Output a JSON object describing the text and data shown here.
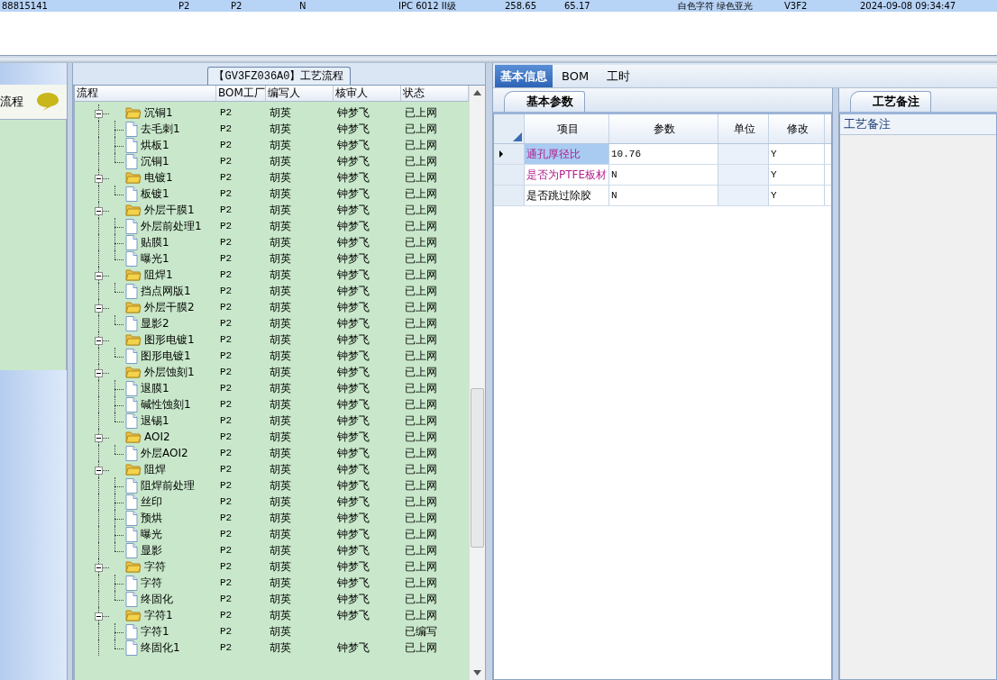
{
  "top_row": {
    "selected": true,
    "cells": [
      "88815141",
      "P2",
      "P2",
      "N",
      "IPC 6012 II级",
      "258.65",
      "65.17",
      "白色字符 绿色亚光",
      "V3F2",
      "2024-09-08 09:34:47"
    ]
  },
  "left_panel": {
    "title": "流程"
  },
  "process_panel": {
    "title": "【GV3FZ036A0】工艺流程",
    "columns": [
      "流程",
      "BOM工厂",
      "编写人",
      "核审人",
      "状态"
    ],
    "rows": [
      {
        "name": "沉铜1",
        "bom": "P2",
        "writer": "胡英",
        "reviewer": "钟梦飞",
        "status": "已上网",
        "expanded": true,
        "children": [
          {
            "name": "去毛刺1",
            "bom": "P2",
            "writer": "胡英",
            "reviewer": "钟梦飞",
            "status": "已上网"
          },
          {
            "name": "烘板1",
            "bom": "P2",
            "writer": "胡英",
            "reviewer": "钟梦飞",
            "status": "已上网"
          },
          {
            "name": "沉铜1",
            "bom": "P2",
            "writer": "胡英",
            "reviewer": "钟梦飞",
            "status": "已上网"
          }
        ]
      },
      {
        "name": "电镀1",
        "bom": "P2",
        "writer": "胡英",
        "reviewer": "钟梦飞",
        "status": "已上网",
        "expanded": true,
        "children": [
          {
            "name": "板镀1",
            "bom": "P2",
            "writer": "胡英",
            "reviewer": "钟梦飞",
            "status": "已上网"
          }
        ]
      },
      {
        "name": "外层干膜1",
        "bom": "P2",
        "writer": "胡英",
        "reviewer": "钟梦飞",
        "status": "已上网",
        "expanded": true,
        "children": [
          {
            "name": "外层前处理1",
            "bom": "P2",
            "writer": "胡英",
            "reviewer": "钟梦飞",
            "status": "已上网"
          },
          {
            "name": "贴膜1",
            "bom": "P2",
            "writer": "胡英",
            "reviewer": "钟梦飞",
            "status": "已上网"
          },
          {
            "name": "曝光1",
            "bom": "P2",
            "writer": "胡英",
            "reviewer": "钟梦飞",
            "status": "已上网"
          }
        ]
      },
      {
        "name": "阻焊1",
        "bom": "P2",
        "writer": "胡英",
        "reviewer": "钟梦飞",
        "status": "已上网",
        "expanded": true,
        "children": [
          {
            "name": "挡点网版1",
            "bom": "P2",
            "writer": "胡英",
            "reviewer": "钟梦飞",
            "status": "已上网"
          }
        ]
      },
      {
        "name": "外层干膜2",
        "bom": "P2",
        "writer": "胡英",
        "reviewer": "钟梦飞",
        "status": "已上网",
        "expanded": true,
        "children": [
          {
            "name": "显影2",
            "bom": "P2",
            "writer": "胡英",
            "reviewer": "钟梦飞",
            "status": "已上网"
          }
        ]
      },
      {
        "name": "图形电镀1",
        "bom": "P2",
        "writer": "胡英",
        "reviewer": "钟梦飞",
        "status": "已上网",
        "expanded": true,
        "children": [
          {
            "name": "图形电镀1",
            "bom": "P2",
            "writer": "胡英",
            "reviewer": "钟梦飞",
            "status": "已上网"
          }
        ]
      },
      {
        "name": "外层蚀刻1",
        "bom": "P2",
        "writer": "胡英",
        "reviewer": "钟梦飞",
        "status": "已上网",
        "expanded": true,
        "children": [
          {
            "name": "退膜1",
            "bom": "P2",
            "writer": "胡英",
            "reviewer": "钟梦飞",
            "status": "已上网"
          },
          {
            "name": "碱性蚀刻1",
            "bom": "P2",
            "writer": "胡英",
            "reviewer": "钟梦飞",
            "status": "已上网"
          },
          {
            "name": "退锡1",
            "bom": "P2",
            "writer": "胡英",
            "reviewer": "钟梦飞",
            "status": "已上网"
          }
        ]
      },
      {
        "name": "AOI2",
        "bom": "P2",
        "writer": "胡英",
        "reviewer": "钟梦飞",
        "status": "已上网",
        "expanded": true,
        "children": [
          {
            "name": "外层AOI2",
            "bom": "P2",
            "writer": "胡英",
            "reviewer": "钟梦飞",
            "status": "已上网"
          }
        ]
      },
      {
        "name": "阻焊",
        "bom": "P2",
        "writer": "胡英",
        "reviewer": "钟梦飞",
        "status": "已上网",
        "expanded": true,
        "children": [
          {
            "name": "阻焊前处理",
            "bom": "P2",
            "writer": "胡英",
            "reviewer": "钟梦飞",
            "status": "已上网"
          },
          {
            "name": "丝印",
            "bom": "P2",
            "writer": "胡英",
            "reviewer": "钟梦飞",
            "status": "已上网"
          },
          {
            "name": "预烘",
            "bom": "P2",
            "writer": "胡英",
            "reviewer": "钟梦飞",
            "status": "已上网"
          },
          {
            "name": "曝光",
            "bom": "P2",
            "writer": "胡英",
            "reviewer": "钟梦飞",
            "status": "已上网"
          },
          {
            "name": "显影",
            "bom": "P2",
            "writer": "胡英",
            "reviewer": "钟梦飞",
            "status": "已上网"
          }
        ]
      },
      {
        "name": "字符",
        "bom": "P2",
        "writer": "胡英",
        "reviewer": "钟梦飞",
        "status": "已上网",
        "expanded": true,
        "children": [
          {
            "name": "字符",
            "bom": "P2",
            "writer": "胡英",
            "reviewer": "钟梦飞",
            "status": "已上网"
          },
          {
            "name": "终固化",
            "bom": "P2",
            "writer": "胡英",
            "reviewer": "钟梦飞",
            "status": "已上网"
          }
        ]
      },
      {
        "name": "字符1",
        "bom": "P2",
        "writer": "胡英",
        "reviewer": "钟梦飞",
        "status": "已上网",
        "expanded": true,
        "children": [
          {
            "name": "字符1",
            "bom": "P2",
            "writer": "胡英",
            "status": "已编写"
          },
          {
            "name": "终固化1",
            "bom": "P2",
            "writer": "胡英",
            "reviewer": "钟梦飞",
            "status": "已上网"
          }
        ]
      }
    ]
  },
  "detail_tabs": [
    {
      "label": "基本信息",
      "selected": true
    },
    {
      "label": "BOM",
      "selected": false
    },
    {
      "label": "工时",
      "selected": false
    }
  ],
  "params_panel": {
    "tab": "基本参数",
    "columns": [
      "项目",
      "参数",
      "单位",
      "修改"
    ],
    "rows": [
      {
        "item": "通孔厚径比",
        "highlighted": true,
        "value": "10.76",
        "modify": "Y",
        "current": true,
        "selected": true
      },
      {
        "item": "是否为PTFE板材",
        "highlighted": true,
        "value": "N",
        "modify": "Y",
        "current": false,
        "selected": false
      },
      {
        "item": "是否跳过除胶",
        "highlighted": false,
        "value": "N",
        "modify": "Y",
        "current": false,
        "selected": false
      }
    ]
  },
  "notes_panel": {
    "tab": "工艺备注",
    "label": "工艺备注"
  }
}
